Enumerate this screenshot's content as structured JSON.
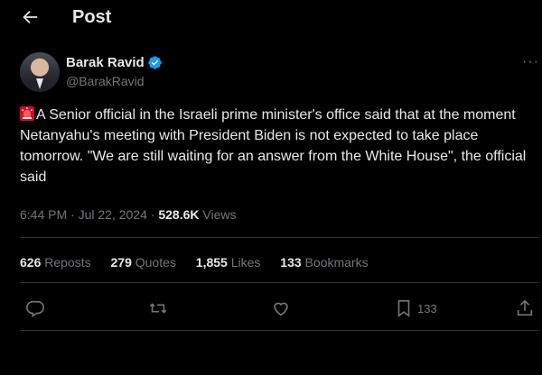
{
  "header": {
    "title": "Post",
    "back_icon": "arrow-left-icon"
  },
  "author": {
    "name": "Barak Ravid",
    "handle": "@BarakRavid",
    "verified_color": "#1d9bf0",
    "more_label": "···"
  },
  "tweet": {
    "emoji": "siren-emoji",
    "text": "A Senior official in the Israeli prime minister's office said that at the moment Netanyahu's meeting with President Biden is not expected to take place tomorrow. \"We are still waiting for an answer from the White House\", the official said"
  },
  "meta": {
    "time": "6:44 PM",
    "date": "Jul 22, 2024",
    "views_count": "528.6K",
    "views_label": "Views"
  },
  "stats": [
    {
      "count": "626",
      "label": "Reposts"
    },
    {
      "count": "279",
      "label": "Quotes"
    },
    {
      "count": "1,855",
      "label": "Likes"
    },
    {
      "count": "133",
      "label": "Bookmarks"
    }
  ],
  "actions": {
    "bookmark_count": "133"
  },
  "colors": {
    "background": "#000000",
    "text": "#e7e9ea",
    "muted": "#71767b",
    "divider": "#2f3336",
    "accent": "#1d9bf0"
  }
}
